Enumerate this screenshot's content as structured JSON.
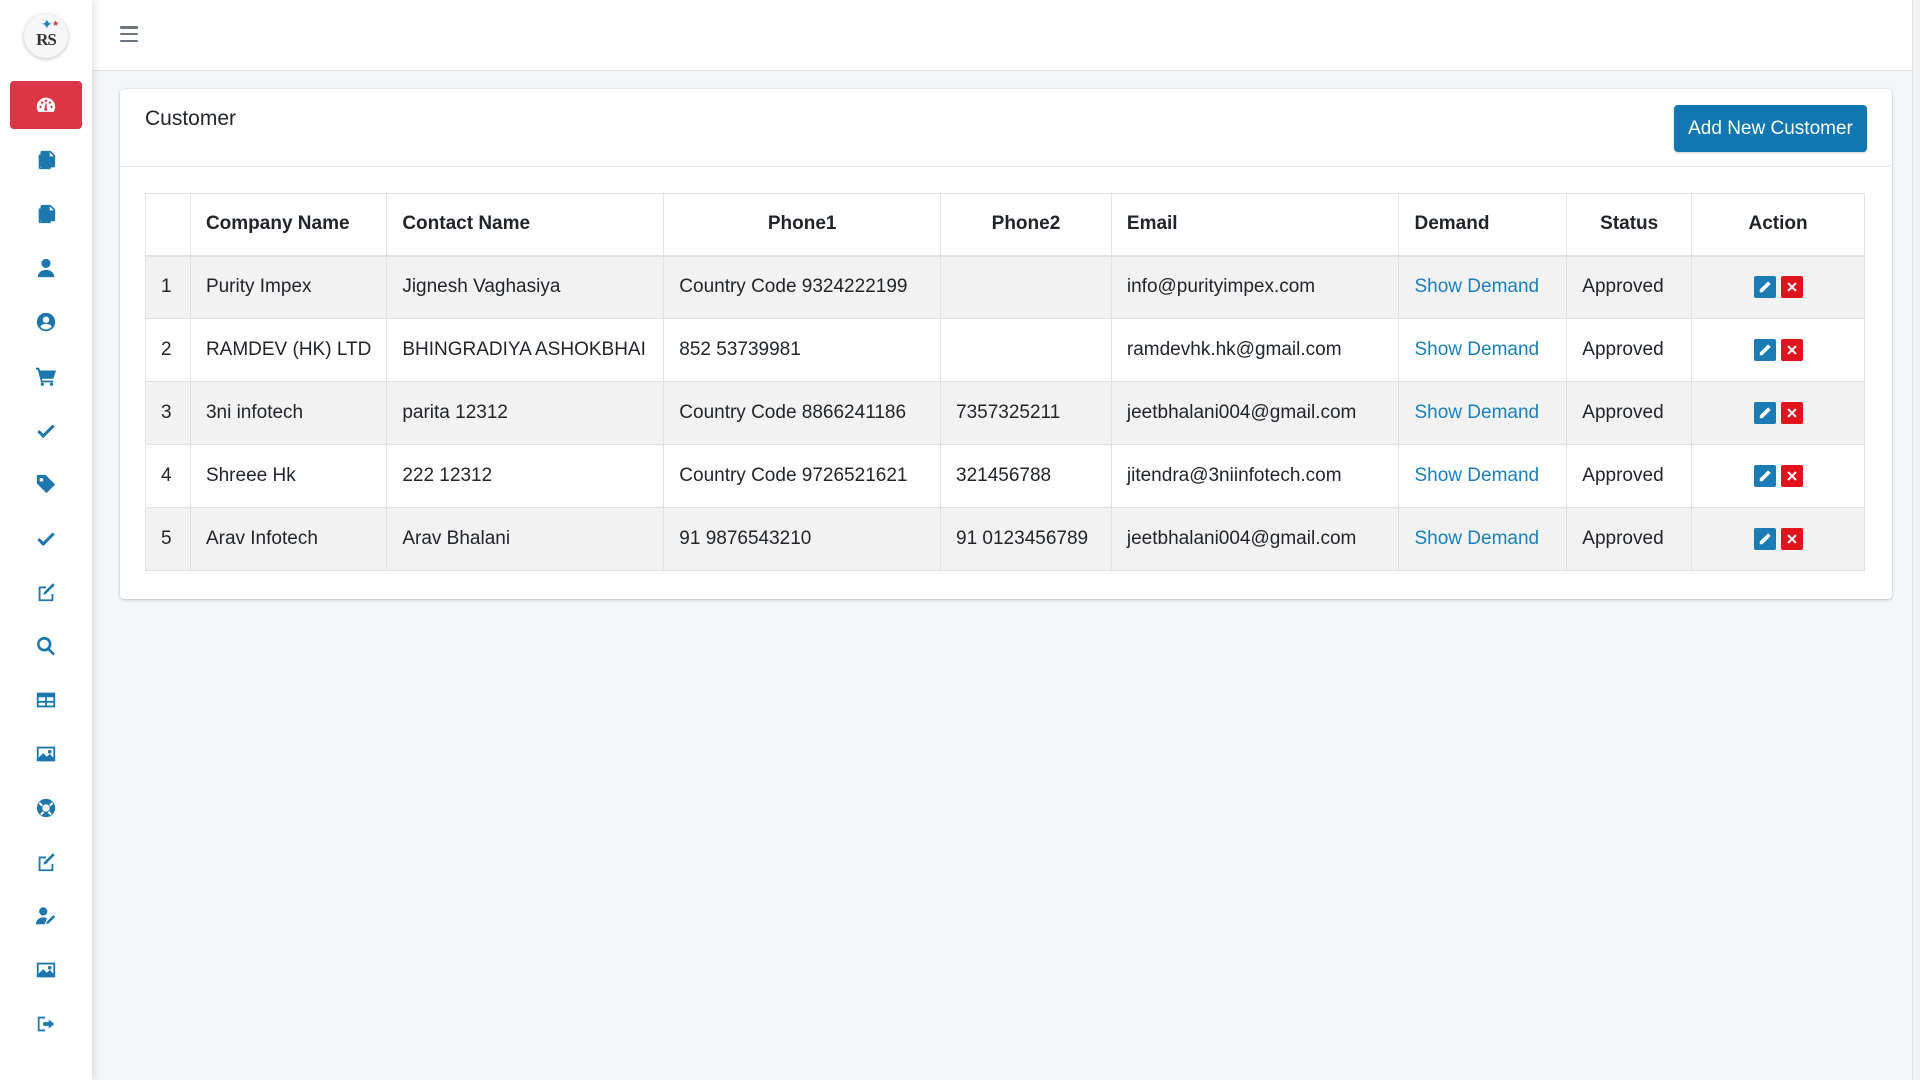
{
  "app": {
    "logo_text": "RS"
  },
  "sidebar": {
    "items": [
      {
        "icon": "dashboard-gauge-icon",
        "active": true
      },
      {
        "icon": "copy-documents-icon"
      },
      {
        "icon": "copy-documents-icon"
      },
      {
        "icon": "user-icon"
      },
      {
        "icon": "user-circle-icon"
      },
      {
        "icon": "shopping-cart-icon"
      },
      {
        "icon": "check-icon"
      },
      {
        "icon": "tag-icon"
      },
      {
        "icon": "check-icon"
      },
      {
        "icon": "edit-icon"
      },
      {
        "icon": "search-icon"
      },
      {
        "icon": "table-icon"
      },
      {
        "icon": "image-icon"
      },
      {
        "icon": "life-ring-icon"
      },
      {
        "icon": "edit-icon"
      },
      {
        "icon": "user-edit-icon"
      },
      {
        "icon": "image-icon"
      },
      {
        "icon": "sign-out-icon"
      }
    ]
  },
  "page": {
    "title": "Customer",
    "add_button_label": "Add New Customer"
  },
  "table": {
    "columns": [
      "",
      "Company Name",
      "Contact Name",
      "Phone1",
      "Phone2",
      "Email",
      "Demand",
      "Status",
      "Action"
    ],
    "rows": [
      {
        "no": "1",
        "company": "Purity Impex",
        "contact": "Jignesh Vaghasiya",
        "phone1": "Country Code 9324222199",
        "phone2": "",
        "email": "info@purityimpex.com",
        "demand": "Show Demand",
        "status": "Approved"
      },
      {
        "no": "2",
        "company": "RAMDEV (HK) LTD",
        "contact": "BHINGRADIYA ASHOKBHAI",
        "phone1": "852 53739981",
        "phone2": "",
        "email": "ramdevhk.hk@gmail.com",
        "demand": "Show Demand",
        "status": "Approved"
      },
      {
        "no": "3",
        "company": "3ni infotech",
        "contact": "parita 12312",
        "phone1": "Country Code 8866241186",
        "phone2": "7357325211",
        "email": "jeetbhalani004@gmail.com",
        "demand": "Show Demand",
        "status": "Approved"
      },
      {
        "no": "4",
        "company": "Shreee Hk",
        "contact": "222 12312",
        "phone1": "Country Code 9726521621",
        "phone2": "321456788",
        "email": "jitendra@3niinfotech.com",
        "demand": "Show Demand",
        "status": "Approved"
      },
      {
        "no": "5",
        "company": "Arav Infotech",
        "contact": "Arav Bhalani",
        "phone1": "91 9876543210",
        "phone2": "91 0123456789",
        "email": "jeetbhalani004@gmail.com",
        "demand": "Show Demand",
        "status": "Approved"
      }
    ]
  },
  "colors": {
    "accent": "#1077b0",
    "active_nav": "#dc3545",
    "delete": "#e0141f",
    "link": "#1a7fba"
  }
}
